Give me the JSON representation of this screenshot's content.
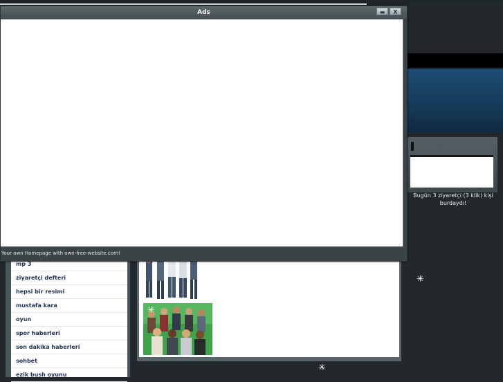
{
  "ads_window": {
    "title": "Ads",
    "footer": "Your own Homepage with own-free-website.com!",
    "controls": {
      "minimize_label": "▬",
      "close_label": "X"
    }
  },
  "sidebar_right": {
    "visits_text": "Bugün 3 ziyaretçi (3 klik) kişi burdaydı!"
  },
  "menu": {
    "items": [
      {
        "label": "mp 3"
      },
      {
        "label": "ziyaretçi defteri"
      },
      {
        "label": "hepsi bir resimi"
      },
      {
        "label": "mustafa kara"
      },
      {
        "label": "oyun"
      },
      {
        "label": "spor haberleri"
      },
      {
        "label": "son dakika haberleri"
      },
      {
        "label": "sohbet"
      },
      {
        "label": "ezik bush oyunu"
      }
    ]
  },
  "decor": {
    "star": "✳"
  },
  "colors": {
    "page_bg": "#22282c",
    "menu_text": "#1d2f52",
    "banner_blue": "#1e4d74"
  }
}
